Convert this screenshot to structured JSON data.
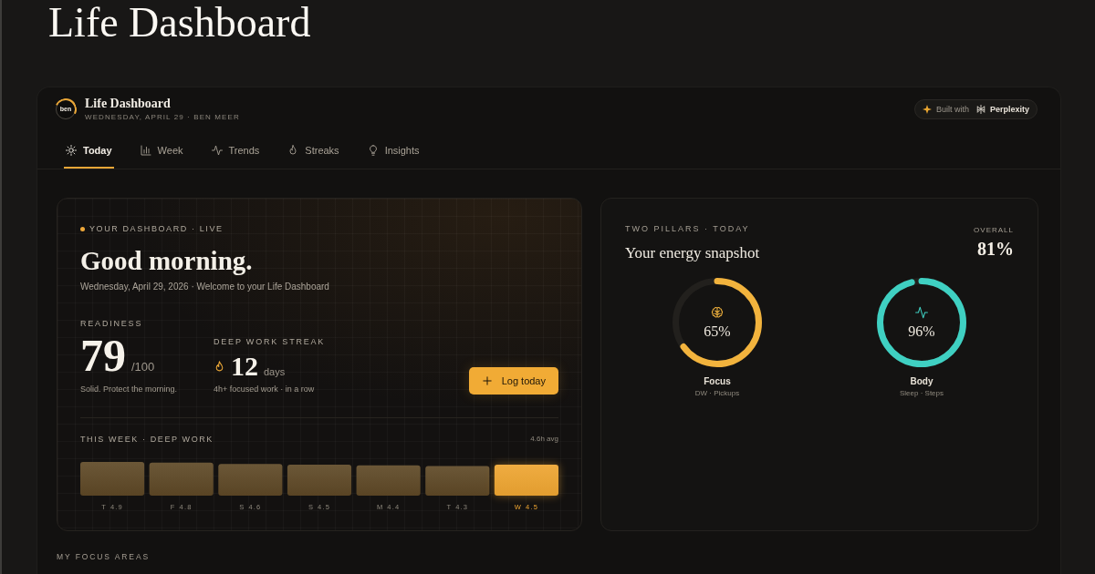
{
  "page_title": "Life Dashboard",
  "app": {
    "logo_text": "ben",
    "title": "Life Dashboard",
    "subtitle": "WEDNESDAY, APRIL 29 · BEN MEER",
    "badge": {
      "prefix": "Built with",
      "brand": "Perplexity"
    }
  },
  "tabs": [
    {
      "label": "Today",
      "selected": true
    },
    {
      "label": "Week",
      "selected": false
    },
    {
      "label": "Trends",
      "selected": false
    },
    {
      "label": "Streaks",
      "selected": false
    },
    {
      "label": "Insights",
      "selected": false
    }
  ],
  "hero": {
    "eyebrow": "YOUR DASHBOARD · LIVE",
    "greeting": "Good morning.",
    "subtitle": "Wednesday, April 29, 2026 · Welcome to your Life Dashboard",
    "readiness": {
      "label": "READINESS",
      "value": "79",
      "max": "/100",
      "note": "Solid. Protect the morning."
    },
    "streak": {
      "label": "DEEP WORK STREAK",
      "value": "12",
      "unit": "days",
      "note": "4h+ focused work · in a row"
    },
    "button": {
      "label": "Log today"
    },
    "week": {
      "title": "THIS WEEK · DEEP WORK",
      "average": "4.6h avg",
      "chart_data": {
        "type": "bar",
        "categories": [
          "T",
          "F",
          "S",
          "S",
          "M",
          "T",
          "W"
        ],
        "series": [
          {
            "color": "#5e4826",
            "values": [
              4.9,
              4.8,
              4.6,
              4.5,
              4.4,
              4.3,
              null
            ]
          },
          {
            "color": "#eea531",
            "values": [
              null,
              null,
              null,
              null,
              null,
              null,
              4.5
            ]
          }
        ],
        "data_labels": true
      }
    }
  },
  "pillars_card": {
    "eyebrow": "TWO PILLARS · TODAY",
    "title": "Your energy snapshot",
    "overall_label": "OVERALL",
    "overall_value": "81%",
    "pillars": [
      {
        "kind": "focus",
        "name": "Focus",
        "detail": "DW · Pickups",
        "value": "65%",
        "level": 0.65,
        "color": "#f2b33d"
      },
      {
        "kind": "body",
        "name": "Body",
        "detail": "Sleep · Steps",
        "value": "96%",
        "level": 0.96,
        "color": "#3fd0c2"
      }
    ]
  },
  "focus_areas": {
    "eyebrow": "MY FOCUS AREAS"
  }
}
